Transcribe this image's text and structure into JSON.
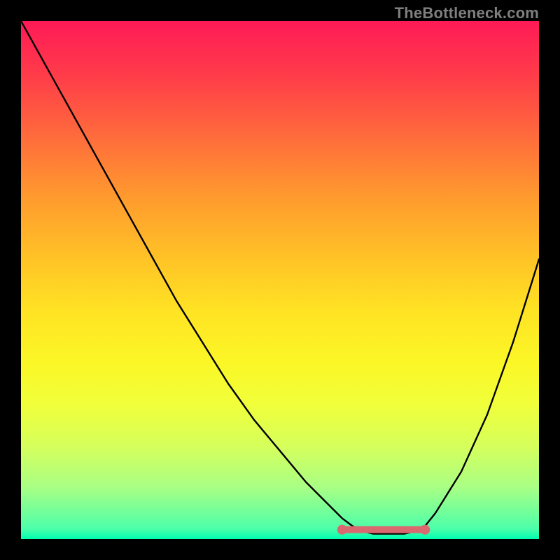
{
  "watermark": "TheBottleneck.com",
  "chart_data": {
    "type": "line",
    "title": "",
    "xlabel": "",
    "ylabel": "",
    "xlim": [
      0,
      100
    ],
    "ylim": [
      0,
      100
    ],
    "series": [
      {
        "name": "curve",
        "x": [
          0,
          5,
          10,
          15,
          20,
          25,
          30,
          35,
          40,
          45,
          50,
          55,
          60,
          62,
          64,
          66,
          68,
          70,
          72,
          74,
          76,
          78,
          80,
          85,
          90,
          95,
          100
        ],
        "y": [
          100,
          91,
          82,
          73,
          64,
          55,
          46,
          38,
          30,
          23,
          17,
          11,
          6,
          4,
          2.5,
          1.5,
          1,
          1,
          1,
          1,
          1.5,
          2.5,
          5,
          13,
          24,
          38,
          54
        ]
      }
    ],
    "markers": [
      {
        "name": "flat-region-left",
        "x": 62,
        "y": 1.8
      },
      {
        "name": "flat-region-right",
        "x": 78,
        "y": 1.8
      }
    ],
    "flat_segment": {
      "x0": 62,
      "x1": 78,
      "y": 1.8
    },
    "colors": {
      "curve": "#000000",
      "marker": "#d9696f",
      "flat_segment": "#d9696f"
    }
  }
}
